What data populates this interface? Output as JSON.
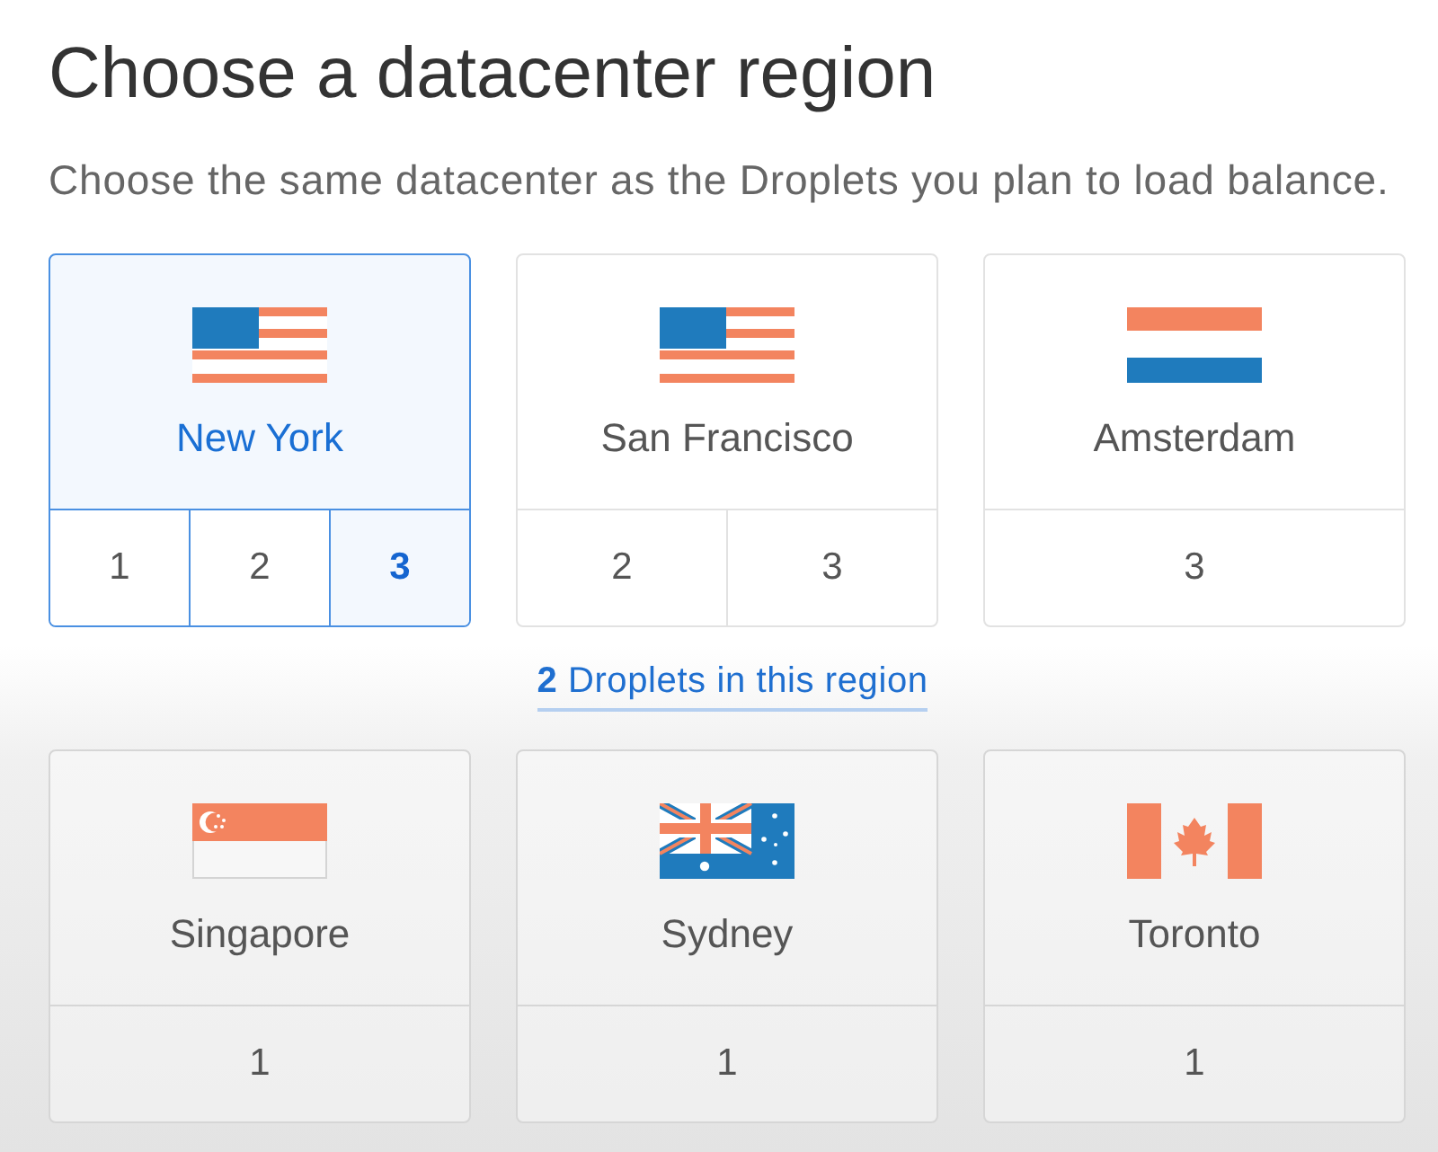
{
  "heading": "Choose a datacenter region",
  "description": "Choose the same datacenter as the Droplets you plan to load balance.",
  "regions_row_1": [
    {
      "name": "New York",
      "kind": "us",
      "selected": true,
      "datacenters": [
        {
          "label": "1",
          "selected": false
        },
        {
          "label": "2",
          "selected": false
        },
        {
          "label": "3",
          "selected": true
        }
      ]
    },
    {
      "name": "San Francisco",
      "kind": "us",
      "selected": false,
      "datacenters": [
        {
          "label": "2",
          "selected": false
        },
        {
          "label": "3",
          "selected": false
        }
      ]
    },
    {
      "name": "Amsterdam",
      "kind": "nl",
      "selected": false,
      "datacenters": [
        {
          "label": "3",
          "selected": false
        }
      ]
    }
  ],
  "droplets_link": "**2** Droplets in this region",
  "regions_row_2": [
    {
      "name": "Singapore",
      "kind": "sg",
      "selected": false,
      "datacenters": [
        {
          "label": "1",
          "selected": false
        }
      ]
    },
    {
      "name": "Sydney",
      "kind": "au",
      "selected": false,
      "datacenters": [
        {
          "label": "1",
          "selected": false
        }
      ]
    },
    {
      "name": "Toronto",
      "kind": "ca",
      "selected": false,
      "datacenters": [
        {
          "label": "1",
          "selected": false
        }
      ]
    }
  ]
}
